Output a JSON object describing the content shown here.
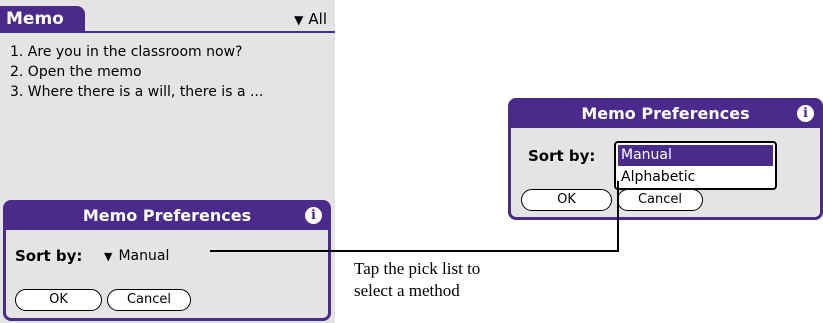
{
  "colors": {
    "accent": "#4a2a8a",
    "screen_bg": "#e4e4e4"
  },
  "memo_app": {
    "title": "Memo",
    "category": "All",
    "items": [
      "1. Are  you in the classroom now?",
      "2. Open the memo",
      "3. Where there is a will, there is a ..."
    ]
  },
  "dialog_closed": {
    "title": "Memo Preferences",
    "info_icon": "i",
    "sort_label": "Sort by:",
    "sort_value": "Manual",
    "ok_label": "OK",
    "cancel_label": "Cancel"
  },
  "dialog_open": {
    "title": "Memo Preferences",
    "info_icon": "i",
    "sort_label": "Sort by:",
    "options": [
      "Manual",
      "Alphabetic"
    ],
    "selected": "Manual",
    "ok_label": "OK",
    "cancel_label": "Cancel"
  },
  "callout": {
    "line1": "Tap the pick list to",
    "line2": "select a method"
  },
  "icons": {
    "dropdown": "triangle-down-icon",
    "info": "info-icon"
  }
}
